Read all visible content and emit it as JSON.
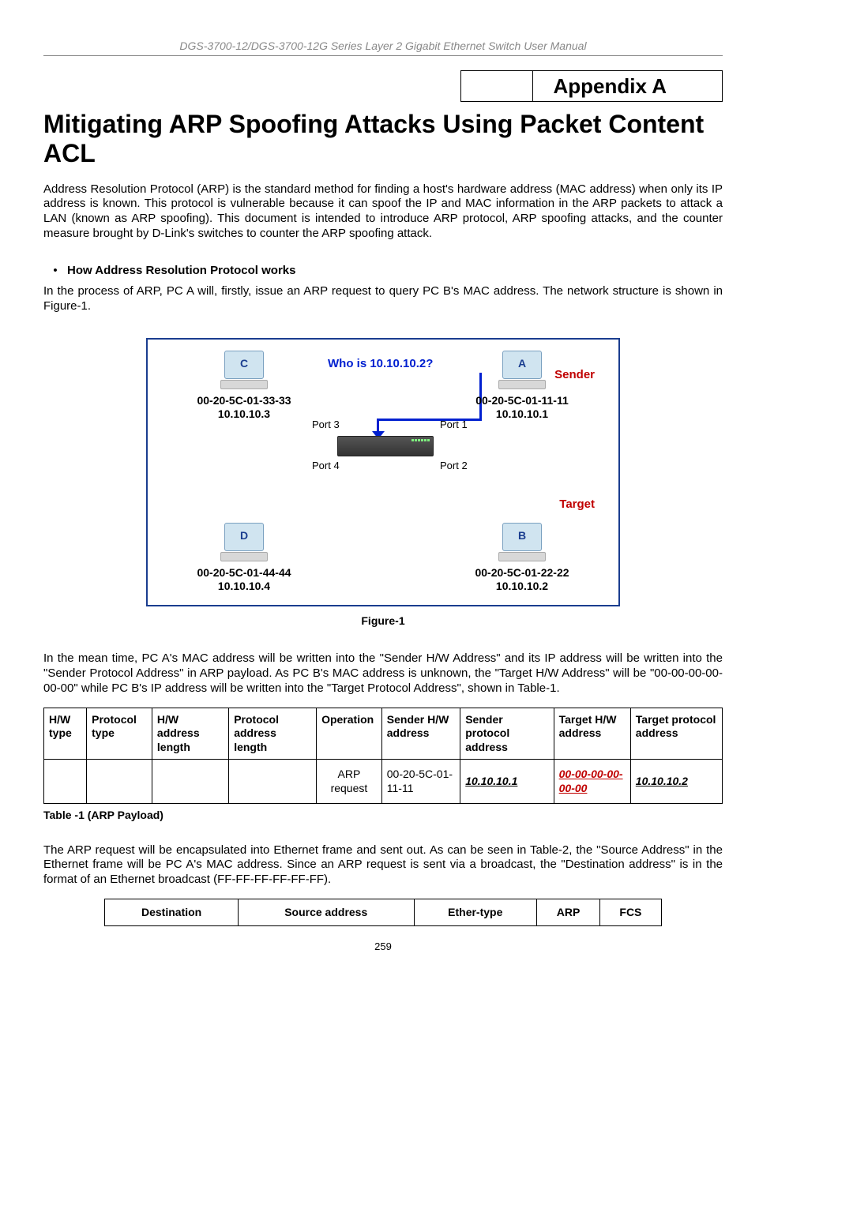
{
  "header": "DGS-3700-12/DGS-3700-12G Series Layer 2 Gigabit Ethernet Switch User Manual",
  "appendix": "Appendix A",
  "title": "Mitigating ARP Spoofing Attacks Using Packet Content ACL",
  "intro": "Address Resolution Protocol (ARP) is the standard method for finding a host's hardware address (MAC address) when only its IP address is known. This protocol is vulnerable because it can spoof the IP and MAC information in the ARP packets to attack a LAN (known as ARP spoofing). This document is intended to introduce ARP protocol, ARP spoofing attacks, and the counter measure brought by D-Link's switches to counter the ARP spoofing attack.",
  "bullet1": "How Address Resolution Protocol works",
  "para2": "In the process of ARP, PC A will, firstly, issue an ARP request to query PC B's MAC address. The network structure is shown in Figure-1.",
  "figure": {
    "whois": "Who is 10.10.10.2?",
    "sender": "Sender",
    "target": "Target",
    "port1": "Port 1",
    "port2": "Port 2",
    "port3": "Port 3",
    "port4": "Port 4",
    "pcA": {
      "letter": "A",
      "mac": "00-20-5C-01-11-11",
      "ip": "10.10.10.1"
    },
    "pcB": {
      "letter": "B",
      "mac": "00-20-5C-01-22-22",
      "ip": "10.10.10.2"
    },
    "pcC": {
      "letter": "C",
      "mac": "00-20-5C-01-33-33",
      "ip": "10.10.10.3"
    },
    "pcD": {
      "letter": "D",
      "mac": "00-20-5C-01-44-44",
      "ip": "10.10.10.4"
    },
    "caption": "Figure-1"
  },
  "para3": "In the mean time, PC A's MAC address will be written into the \"Sender H/W Address\" and its IP address will be written into the \"Sender Protocol Address\" in ARP payload. As PC B's MAC address is unknown, the \"Target H/W Address\" will be \"00-00-00-00-00-00\" while PC B's IP address will be written into the \"Target Protocol Address\", shown in Table-1.",
  "table1": {
    "headers": [
      "H/W type",
      "Protocol type",
      "H/W address length",
      "Protocol address length",
      "Operation",
      "Sender H/W address",
      "Sender protocol address",
      "Target H/W address",
      "Target protocol address"
    ],
    "row": {
      "operation": "ARP request",
      "senderHW": "00-20-5C-01-11-11",
      "senderProto": "10.10.10.1",
      "targetHW": "00-00-00-00-00-00",
      "targetProto": "10.10.10.2"
    },
    "caption": "Table -1 (ARP Payload)"
  },
  "para4": "The ARP request will be encapsulated into Ethernet frame and sent out. As can be seen in Table-2, the \"Source Address\" in the Ethernet frame will be PC A's MAC address. Since an ARP request is sent via a broadcast, the \"Destination address\" is in the format of an Ethernet broadcast (FF-FF-FF-FF-FF-FF).",
  "table2": {
    "headers": [
      "Destination",
      "Source address",
      "Ether-type",
      "ARP",
      "FCS"
    ]
  },
  "pageNum": "259"
}
